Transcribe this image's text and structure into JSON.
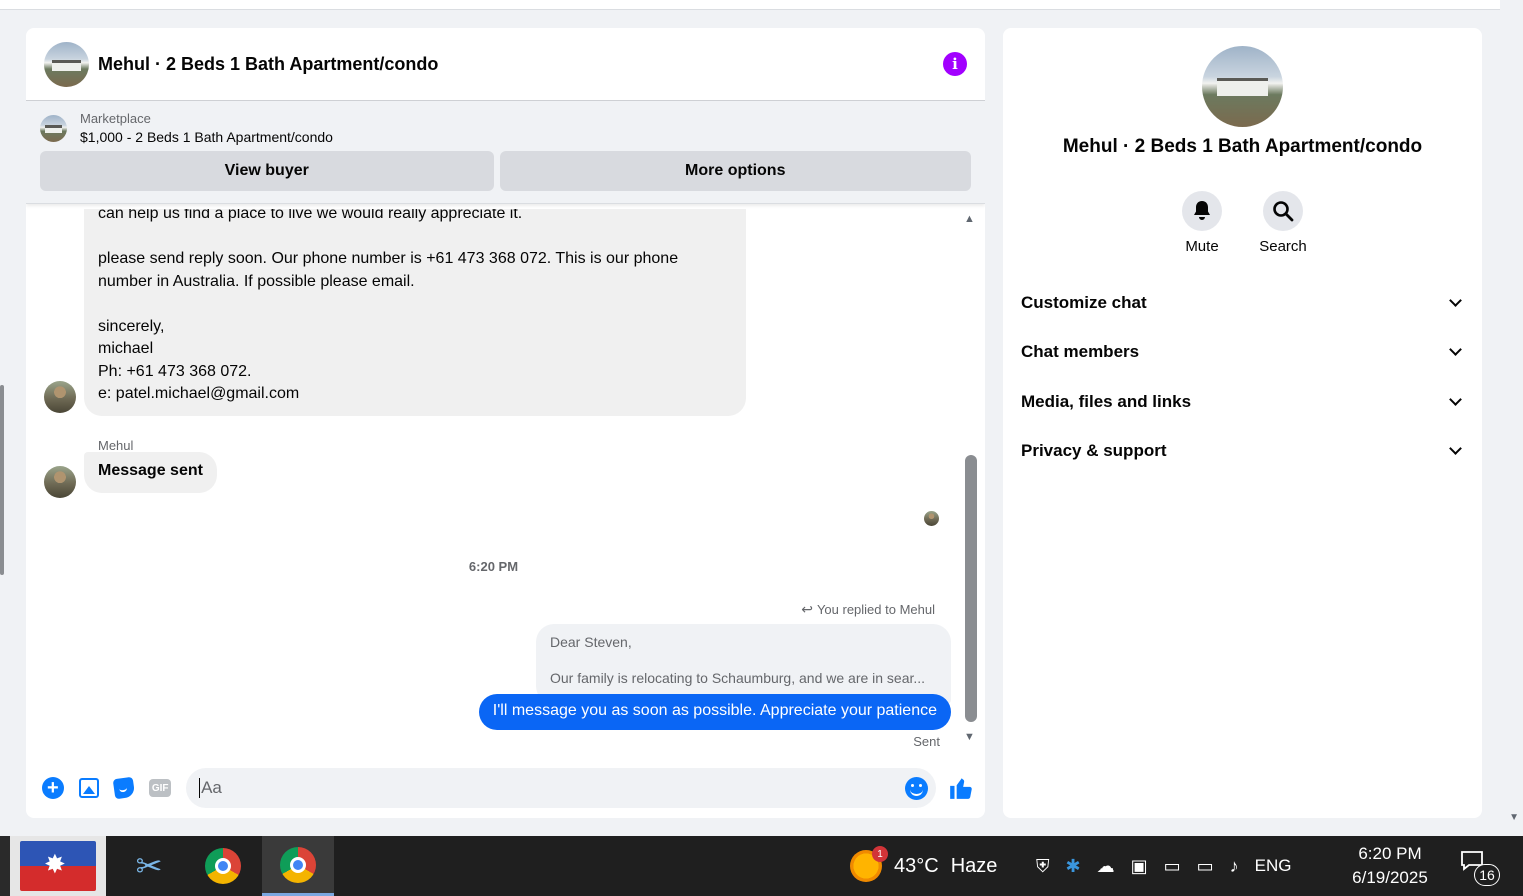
{
  "chat": {
    "title": "Mehul · 2 Beds 1 Bath Apartment/condo",
    "marketplace_label": "Marketplace",
    "listing": "$1,000 - 2 Beds 1 Bath Apartment/condo",
    "view_buyer_label": "View buyer",
    "more_options_label": "More options"
  },
  "messages": {
    "long_message_paragraphs": [
      "can help us find a place to live we would really appreciate it.",
      "please send reply soon.  Our phone number is +61 473 368 072.  This is our phone number in Australia.  If possible please email.",
      "sincerely,\nmichael\nPh: +61 473 368 072.\ne: patel.michael@gmail.com"
    ],
    "sender_name": "Mehul",
    "short_message": "Message sent",
    "timestamp": "6:20 PM",
    "replied_to": "You replied to Mehul",
    "quoted_line1": "Dear Steven,",
    "quoted_line2": "Our family is relocating to Schaumburg, and we are in sear...",
    "outgoing_message": "I'll message you as soon as possible. Appreciate your patience",
    "status": "Sent"
  },
  "composer": {
    "placeholder": "Aa",
    "gif_label": "GIF"
  },
  "side": {
    "title": "Mehul · 2 Beds 1 Bath Apartment/condo",
    "mute_label": "Mute",
    "search_label": "Search",
    "sections": [
      "Customize chat",
      "Chat members",
      "Media, files and links",
      "Privacy & support"
    ]
  },
  "taskbar": {
    "weather_temp": "43°C",
    "weather_desc": "Haze",
    "weather_badge": "1",
    "language": "ENG",
    "time": "6:20 PM",
    "date": "6/19/2025",
    "notifications": "16"
  }
}
